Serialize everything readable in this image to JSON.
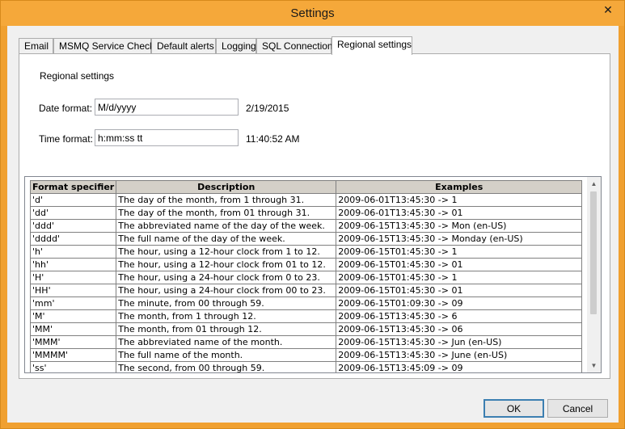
{
  "window": {
    "title": "Settings",
    "close_glyph": "✕"
  },
  "tabs": [
    {
      "label": "Email"
    },
    {
      "label": "MSMQ Service Check"
    },
    {
      "label": "Default alerts"
    },
    {
      "label": "Logging"
    },
    {
      "label": "SQL Connections"
    },
    {
      "label": "Regional settings",
      "active": true
    }
  ],
  "regional": {
    "section_title": "Regional settings",
    "date": {
      "label": "Date format:",
      "value": "M/d/yyyy",
      "preview": "2/19/2015"
    },
    "time": {
      "label": "Time format:",
      "value": "h:mm:ss tt",
      "preview": "11:40:52 AM"
    }
  },
  "table": {
    "columns": [
      "Format specifier",
      "Description",
      "Examples"
    ],
    "rows": [
      [
        "'d'",
        "The day of the month, from 1 through 31.",
        "2009-06-01T13:45:30 -> 1"
      ],
      [
        "'dd'",
        "The day of the month, from 01 through 31.",
        "2009-06-01T13:45:30 -> 01"
      ],
      [
        "'ddd'",
        "The abbreviated name of the day of the week.",
        "2009-06-15T13:45:30 -> Mon (en-US)"
      ],
      [
        "'dddd'",
        "The full name of the day of the week.",
        "2009-06-15T13:45:30 -> Monday (en-US)"
      ],
      [
        "'h'",
        "The hour, using a 12-hour clock from 1 to 12.",
        "2009-06-15T01:45:30 -> 1"
      ],
      [
        "'hh'",
        "The hour, using a 12-hour clock from 01 to 12.",
        "2009-06-15T01:45:30 -> 01"
      ],
      [
        "'H'",
        "The hour, using a 24-hour clock from 0 to 23.",
        "2009-06-15T01:45:30 -> 1"
      ],
      [
        "'HH'",
        "The hour, using a 24-hour clock from 00 to 23.",
        "2009-06-15T01:45:30 -> 01"
      ],
      [
        "'mm'",
        "The minute, from 00 through 59.",
        "2009-06-15T01:09:30 -> 09"
      ],
      [
        "'M'",
        "The month, from 1 through 12.",
        "2009-06-15T13:45:30 -> 6"
      ],
      [
        "'MM'",
        "The month, from 01 through 12.",
        "2009-06-15T13:45:30 -> 06"
      ],
      [
        "'MMM'",
        "The abbreviated name of the month.",
        "2009-06-15T13:45:30 -> Jun (en-US)"
      ],
      [
        "'MMMM'",
        "The full name of the month.",
        "2009-06-15T13:45:30 -> June (en-US)"
      ],
      [
        "'ss'",
        "The second, from 00 through 59.",
        "2009-06-15T13:45:09 -> 09"
      ]
    ]
  },
  "buttons": {
    "ok": "OK",
    "cancel": "Cancel"
  },
  "colors": {
    "frame": "#f0a030",
    "dialog_bg": "#f0f0f0",
    "panel_bg": "#ffffff",
    "grid_header": "#d4d0c8",
    "default_button_border": "#3c7fb1"
  }
}
